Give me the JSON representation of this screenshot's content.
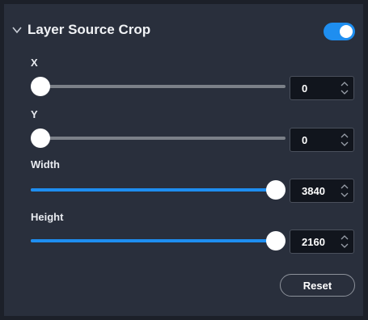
{
  "section": {
    "title": "Layer Source Crop",
    "enabled": true,
    "icons": {
      "collapse": "chevron-down-icon",
      "spin": "spin-arrows-icon"
    },
    "accent_color": "#1e8ef0"
  },
  "fields": {
    "x": {
      "label": "X",
      "value": "0",
      "level": 0.0
    },
    "y": {
      "label": "Y",
      "value": "0",
      "level": 0.0
    },
    "width": {
      "label": "Width",
      "value": "3840",
      "level": 1.0
    },
    "height": {
      "label": "Height",
      "value": "2160",
      "level": 1.0
    }
  },
  "actions": {
    "reset_label": "Reset"
  }
}
